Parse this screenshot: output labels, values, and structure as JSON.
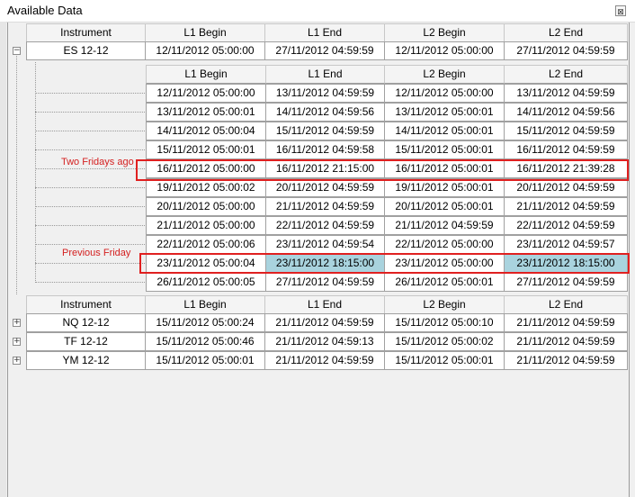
{
  "window": {
    "title": "Available Data",
    "close_glyph": "⊠"
  },
  "columns": [
    "Instrument",
    "L1 Begin",
    "L1 End",
    "L2 Begin",
    "L2 End"
  ],
  "sub_columns": [
    "L1 Begin",
    "L1 End",
    "L2 Begin",
    "L2 End"
  ],
  "top_rows": [
    {
      "instrument": "ES 12-12",
      "expanded": true,
      "l1_begin": "12/11/2012 05:00:00",
      "l1_end": "27/11/2012 04:59:59",
      "l2_begin": "12/11/2012 05:00:00",
      "l2_end": "27/11/2012 04:59:59"
    }
  ],
  "detail_rows": [
    [
      "12/11/2012 05:00:00",
      "13/11/2012 04:59:59",
      "12/11/2012 05:00:00",
      "13/11/2012 04:59:59"
    ],
    [
      "13/11/2012 05:00:01",
      "14/11/2012 04:59:56",
      "13/11/2012 05:00:01",
      "14/11/2012 04:59:56"
    ],
    [
      "14/11/2012 05:00:04",
      "15/11/2012 04:59:59",
      "14/11/2012 05:00:01",
      "15/11/2012 04:59:59"
    ],
    [
      "15/11/2012 05:00:01",
      "16/11/2012 04:59:58",
      "15/11/2012 05:00:01",
      "16/11/2012 04:59:59"
    ],
    [
      "16/11/2012 05:00:00",
      "16/11/2012 21:15:00",
      "16/11/2012 05:00:01",
      "16/11/2012 21:39:28"
    ],
    [
      "19/11/2012 05:00:02",
      "20/11/2012 04:59:59",
      "19/11/2012 05:00:01",
      "20/11/2012 04:59:59"
    ],
    [
      "20/11/2012 05:00:00",
      "21/11/2012 04:59:59",
      "20/11/2012 05:00:01",
      "21/11/2012 04:59:59"
    ],
    [
      "21/11/2012 05:00:00",
      "22/11/2012 04:59:59",
      "21/11/2012 04:59:59",
      "22/11/2012 04:59:59"
    ],
    [
      "22/11/2012 05:00:06",
      "23/11/2012 04:59:54",
      "22/11/2012 05:00:00",
      "23/11/2012 04:59:57"
    ],
    [
      "23/11/2012 05:00:04",
      "23/11/2012 18:15:00",
      "23/11/2012 05:00:00",
      "23/11/2012 18:15:00"
    ],
    [
      "26/11/2012 05:00:05",
      "27/11/2012 04:59:59",
      "26/11/2012 05:00:01",
      "27/11/2012 04:59:59"
    ]
  ],
  "annotations": {
    "two_fridays_ago": "Two Fridays ago",
    "previous_friday": "Previous Friday"
  },
  "other_rows": [
    {
      "instrument": "NQ 12-12",
      "expanded": false,
      "l1_begin": "15/11/2012 05:00:24",
      "l1_end": "21/11/2012 04:59:59",
      "l2_begin": "15/11/2012 05:00:10",
      "l2_end": "21/11/2012 04:59:59"
    },
    {
      "instrument": "TF 12-12",
      "expanded": false,
      "l1_begin": "15/11/2012 05:00:46",
      "l1_end": "21/11/2012 04:59:13",
      "l2_begin": "15/11/2012 05:00:02",
      "l2_end": "21/11/2012 04:59:59"
    },
    {
      "instrument": "YM 12-12",
      "expanded": false,
      "l1_begin": "15/11/2012 05:00:01",
      "l1_end": "21/11/2012 04:59:59",
      "l2_begin": "15/11/2012 05:00:01",
      "l2_end": "21/11/2012 04:59:59"
    }
  ],
  "colors": {
    "highlight": "#a9d3de",
    "annotation": "#e02020"
  }
}
